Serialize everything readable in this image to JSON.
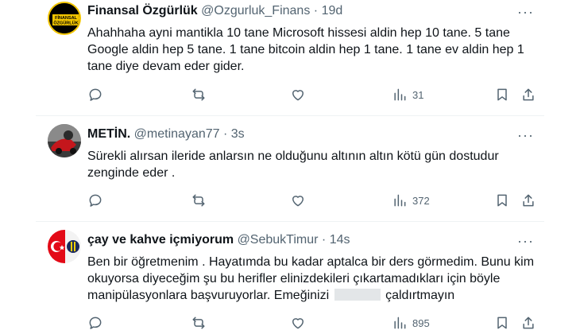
{
  "tweets": [
    {
      "name": "Finansal Özgürlük",
      "handle": "@Ozgurluk_Finans",
      "dot": "·",
      "time": "19d",
      "avatar_text": "FİNANSAL ÖZGÜRLÜK",
      "text": "Ahahhaha ayni mantikla 10 tane Microsoft hissesi aldin hep 10 tane. 5 tane Google aldin hep 5 tane. 1 tane bitcoin aldin hep 1 tane. 1 tane ev aldin hep 1 tane diye devam eder gider.",
      "views": "31"
    },
    {
      "name": "METİN.",
      "handle": "@metinayan77",
      "dot": "·",
      "time": "3s",
      "text": "Sürekli alırsan ileride anlarsın ne olduğunu altının altın kötü gün dostudur zenginde eder .",
      "views": "372"
    },
    {
      "name": "çay ve kahve içmiyorum",
      "handle": "@SebukTimur",
      "dot": "·",
      "time": "14s",
      "text_before": "Ben bir öğretmenim . Hayatımda bu kadar aptalca bir ders görmedim. Bunu kim okuyorsa diyeceğim şu bu herifler elinizdekileri çıkartamadıkları için böyle manipülasyonlara başvuruyorlar. Emeğinizi",
      "text_after": "çaldırtmayın",
      "views": "895"
    }
  ],
  "more_glyph": "···",
  "colors": {
    "text": "#0f1419",
    "muted": "#536471",
    "divider": "#eff3f4",
    "avatar1_bg": "#000000",
    "avatar1_ring": "#f2c500"
  },
  "icons": [
    "reply-icon",
    "retweet-icon",
    "like-icon",
    "views-icon",
    "bookmark-icon",
    "share-icon",
    "more-icon"
  ]
}
